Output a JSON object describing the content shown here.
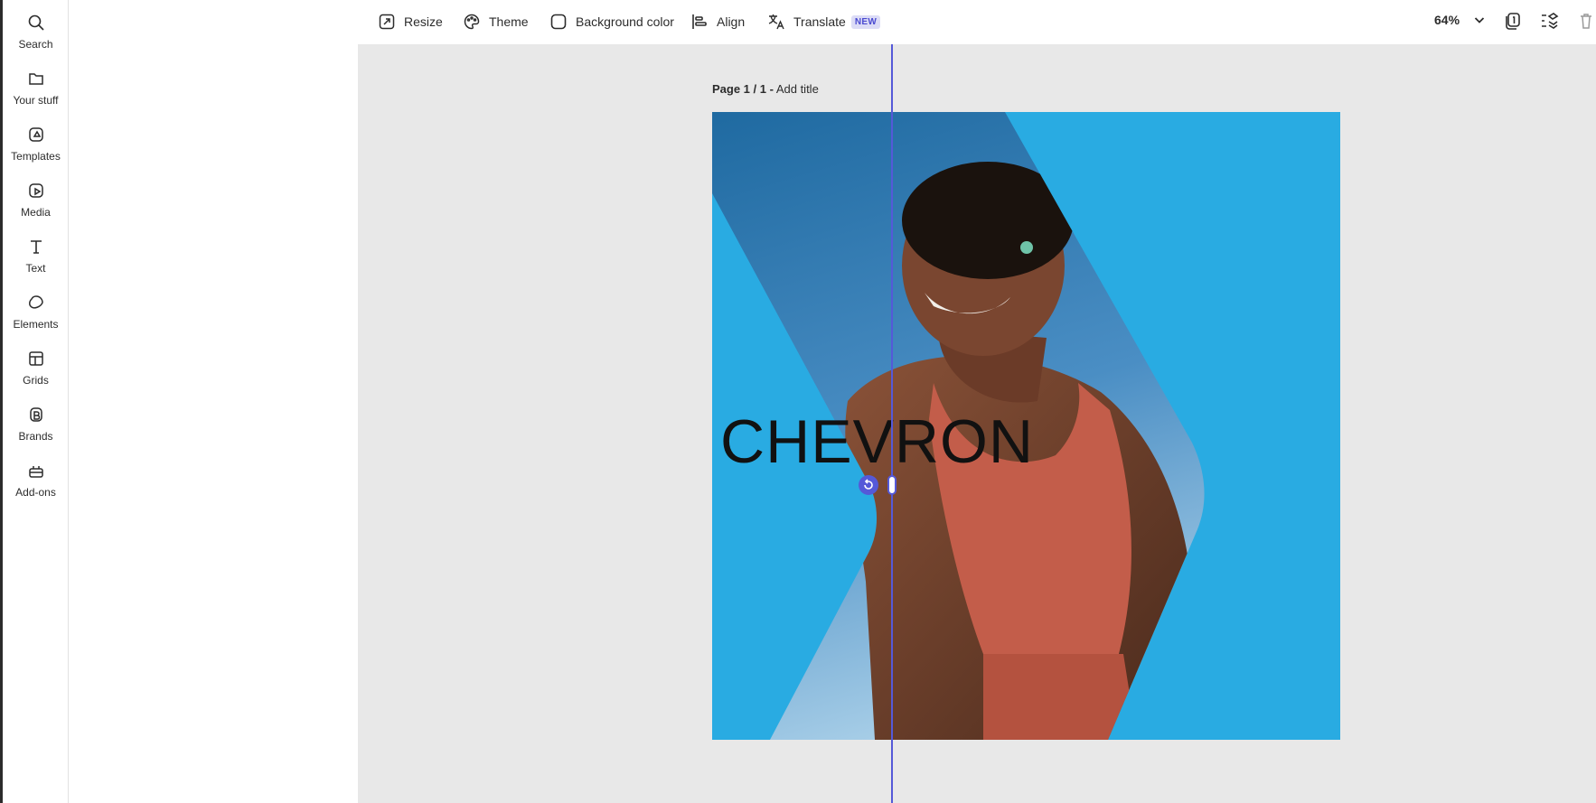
{
  "rail": {
    "items": [
      {
        "label": "Search",
        "icon": "search-icon"
      },
      {
        "label": "Your stuff",
        "icon": "folder-icon"
      },
      {
        "label": "Templates",
        "icon": "templates-icon"
      },
      {
        "label": "Media",
        "icon": "media-icon"
      },
      {
        "label": "Text",
        "icon": "text-icon"
      },
      {
        "label": "Elements",
        "icon": "elements-icon"
      },
      {
        "label": "Grids",
        "icon": "grids-icon"
      },
      {
        "label": "Brands",
        "icon": "brands-icon"
      },
      {
        "label": "Add-ons",
        "icon": "addons-icon"
      }
    ]
  },
  "toolbar": {
    "resize": "Resize",
    "theme": "Theme",
    "background_color": "Background color",
    "align": "Align",
    "translate": "Translate",
    "translate_badge": "NEW",
    "zoom": "64%"
  },
  "page": {
    "label_prefix": "Page 1 / 1 -",
    "title_placeholder": "Add title"
  },
  "canvas": {
    "headline": "CHEVRON",
    "background": "#29abe2",
    "selection_color": "#5559d8"
  }
}
